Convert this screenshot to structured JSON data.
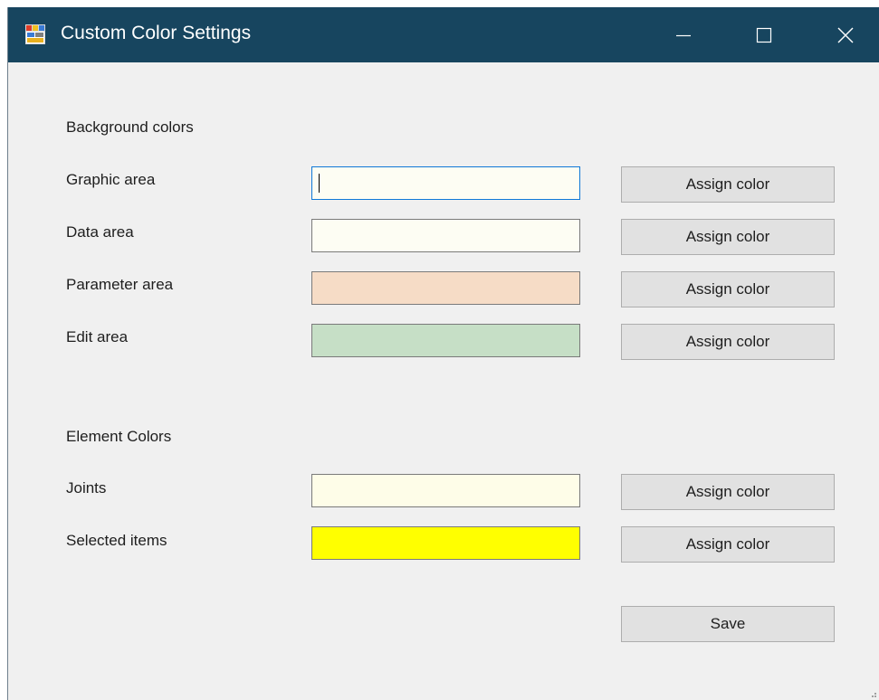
{
  "window": {
    "title": "Custom Color Settings",
    "icons": {
      "app": "app-icon",
      "minimize": "minimize-icon",
      "maximize": "maximize-icon",
      "close": "close-icon"
    }
  },
  "background_section": {
    "heading": "Background colors",
    "rows": [
      {
        "label": "Graphic area",
        "color": "#fdfdf3",
        "button": "Assign color"
      },
      {
        "label": "Data area",
        "color": "#fdfdf3",
        "button": "Assign color"
      },
      {
        "label": "Parameter area",
        "color": "#f6dcc6",
        "button": "Assign color"
      },
      {
        "label": "Edit area",
        "color": "#c6dfc6",
        "button": "Assign color"
      }
    ]
  },
  "element_section": {
    "heading": "Element Colors",
    "rows": [
      {
        "label": "Joints",
        "color": "#fefde8",
        "button": "Assign color"
      },
      {
        "label": "Selected items",
        "color": "#ffff00",
        "button": "Assign color"
      }
    ]
  },
  "save_label": "Save",
  "colors": {
    "titlebar": "#17455f",
    "window_bg": "#f0f0f0",
    "focus_border": "#0f78d7"
  }
}
